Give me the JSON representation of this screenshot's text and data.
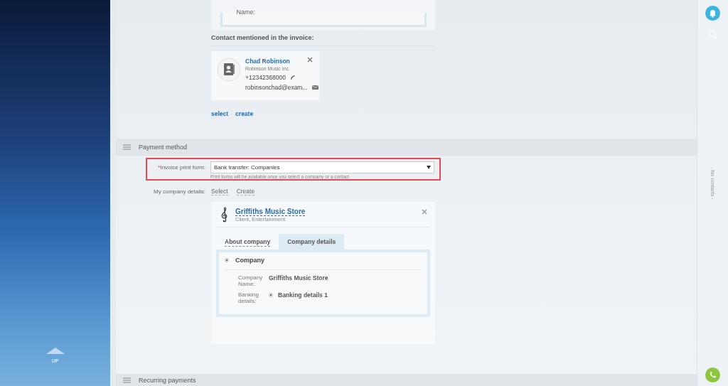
{
  "sidebar": {
    "up_label": "UP"
  },
  "top_card": {
    "label": "Name:"
  },
  "contact_section": {
    "heading": "Contact mentioned in the invoice:",
    "contact": {
      "name": "Chad Robinson",
      "company": "Robinson Music Inc.",
      "phone": "+12342368000",
      "email": "robinsonchad@exam..."
    },
    "links": [
      "select",
      "create"
    ]
  },
  "payment_section": {
    "title": "Payment method",
    "print_form": {
      "label": "Invoice print form:",
      "required_mark": "*",
      "value": "Bank transfer: Companies",
      "hint": "Print forms will be available once you select a company or a contact"
    },
    "company_details": {
      "label": "My company details:",
      "links": [
        "Select",
        "Create"
      ]
    },
    "company_card": {
      "name": "Griffiths Music Store",
      "subtitle": "Client, Entertainment",
      "tabs": [
        {
          "label": "About company",
          "selected": false
        },
        {
          "label": "Company details",
          "selected": true
        }
      ],
      "entity": {
        "label": "Company",
        "checked": true
      },
      "fields": [
        {
          "label": "Company Name:",
          "kind": "text",
          "value": "Griffiths Music Store"
        },
        {
          "label": "Banking details:",
          "kind": "radio",
          "value": "Banking details 1",
          "checked": true
        }
      ]
    }
  },
  "next_section": {
    "title": "Recurring payments"
  },
  "right_rail": {
    "empty_text": "- No contacts -"
  }
}
